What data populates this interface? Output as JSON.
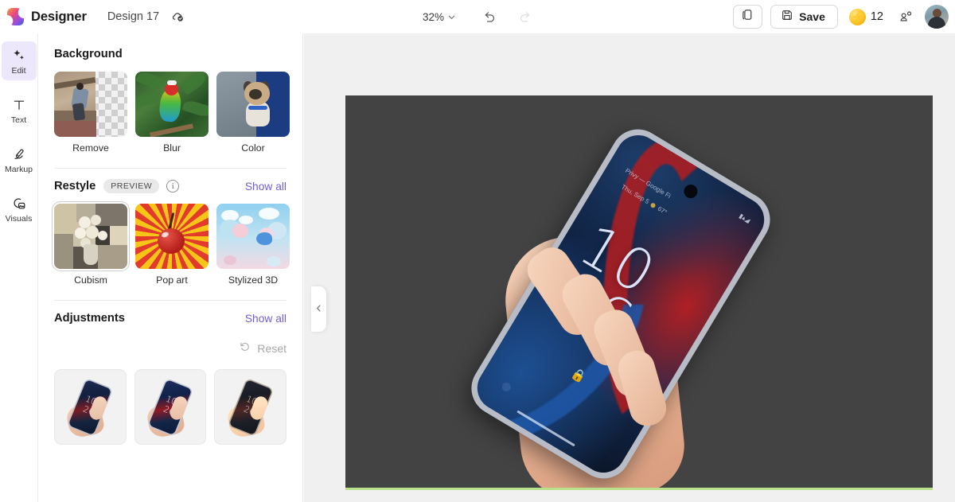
{
  "app": {
    "brand_name": "Designer",
    "document_title": "Design 17",
    "logo_icon": "designer-logo-icon",
    "cloud_saved_icon": "cloud-check-icon"
  },
  "header": {
    "zoom_level": "32%",
    "zoom_chevron_icon": "chevron-down-icon",
    "undo_icon": "undo-arrow-icon",
    "redo_icon": "redo-arrow-icon",
    "duplicate_icon": "duplicate-pages-icon",
    "save_label": "Save",
    "save_icon": "floppy-disk-icon",
    "credits_count": "12",
    "credits_icon": "lightning-coin-icon",
    "share_icon": "share-people-icon",
    "avatar_icon": "user-avatar"
  },
  "rail": {
    "items": [
      {
        "label": "Edit",
        "icon": "sparkles-icon",
        "active": true
      },
      {
        "label": "Text",
        "icon": "text-T-icon",
        "active": false
      },
      {
        "label": "Markup",
        "icon": "pen-markup-icon",
        "active": false
      },
      {
        "label": "Visuals",
        "icon": "visuals-image-icon",
        "active": false
      }
    ]
  },
  "panel": {
    "background": {
      "title": "Background",
      "items": [
        {
          "caption": "Remove",
          "art": "remove"
        },
        {
          "caption": "Blur",
          "art": "blur"
        },
        {
          "caption": "Color",
          "art": "color"
        }
      ]
    },
    "restyle": {
      "title": "Restyle",
      "badge": "PREVIEW",
      "info_icon": "info-circle-icon",
      "show_all": "Show all",
      "items": [
        {
          "caption": "Cubism",
          "art": "cubism",
          "selected": true
        },
        {
          "caption": "Pop art",
          "art": "popart",
          "selected": false
        },
        {
          "caption": "Stylized 3D",
          "art": "s3d",
          "selected": false
        }
      ]
    },
    "adjustments": {
      "title": "Adjustments",
      "show_all": "Show all",
      "reset_label": "Reset",
      "reset_icon": "reset-arrow-icon",
      "presets": [
        {
          "name": "preset-1"
        },
        {
          "name": "preset-2"
        },
        {
          "name": "preset-3"
        }
      ]
    }
  },
  "canvas": {
    "collapse_icon": "chevron-left-icon",
    "artwork": {
      "description": "hand-holding-phone",
      "phone_clock_line1": "10",
      "phone_clock_line2": "26",
      "phone_status_line1": "Privy — Google Fi",
      "phone_status_line2": "Thu, Sep 5",
      "phone_temp": "67°",
      "lock_icon": "lock-icon",
      "camera_icon": "front-camera-dot"
    }
  },
  "colors": {
    "accent_purple": "#6f5fd0",
    "rail_active_bg": "#ece7fb",
    "canvas_bg": "#f0f0f0",
    "artboard_bg": "#434343",
    "credits_gold": "#fdc82f"
  }
}
